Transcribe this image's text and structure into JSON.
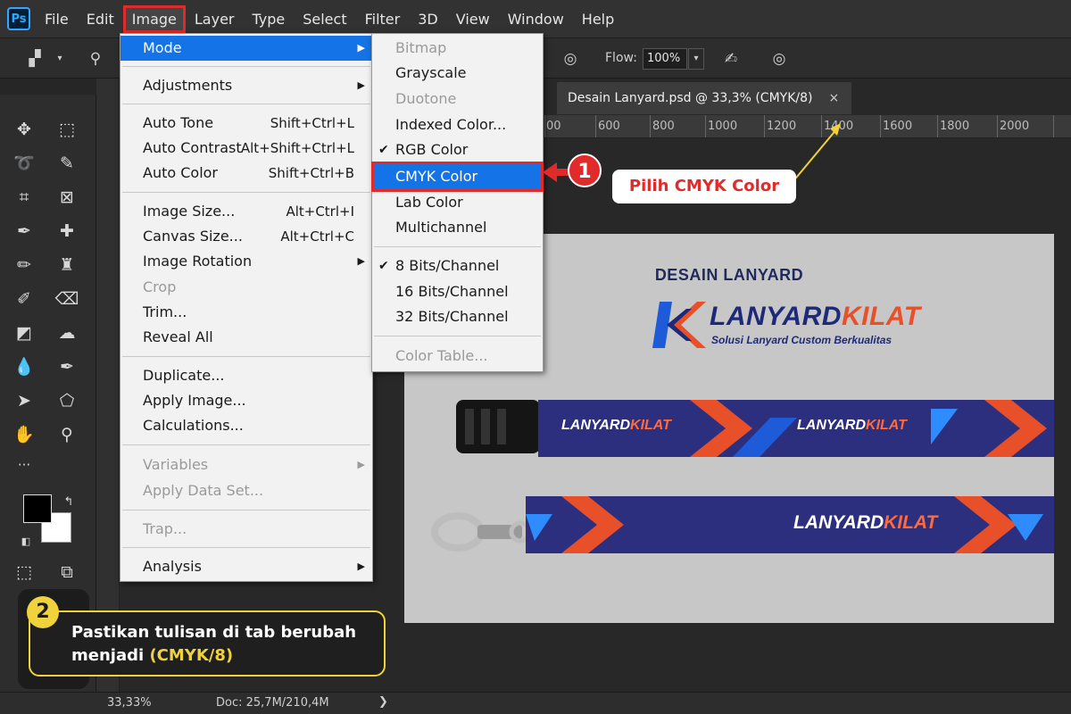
{
  "app": {
    "logo": "Ps"
  },
  "menubar": {
    "items": [
      "File",
      "Edit",
      "Image",
      "Layer",
      "Type",
      "Select",
      "Filter",
      "3D",
      "View",
      "Window",
      "Help"
    ],
    "active": "Image"
  },
  "options": {
    "flow_label": "Flow:",
    "flow_value": "100%"
  },
  "document": {
    "tab_title": "Desain Lanyard.psd @ 33,3% (CMYK/8)",
    "close": "×",
    "ruler_labels": [
      "00",
      "600",
      "800",
      "1000",
      "1200",
      "1400",
      "1600",
      "1800",
      "2000"
    ]
  },
  "image_menu": {
    "mode": "Mode",
    "adjustments": "Adjustments",
    "auto_tone": "Auto Tone",
    "auto_tone_sc": "Shift+Ctrl+L",
    "auto_contrast": "Auto Contrast",
    "auto_contrast_sc": "Alt+Shift+Ctrl+L",
    "auto_color": "Auto Color",
    "auto_color_sc": "Shift+Ctrl+B",
    "image_size": "Image Size...",
    "image_size_sc": "Alt+Ctrl+I",
    "canvas_size": "Canvas Size...",
    "canvas_size_sc": "Alt+Ctrl+C",
    "image_rotation": "Image Rotation",
    "crop": "Crop",
    "trim": "Trim...",
    "reveal_all": "Reveal All",
    "duplicate": "Duplicate...",
    "apply_image": "Apply Image...",
    "calculations": "Calculations...",
    "variables": "Variables",
    "apply_data_set": "Apply Data Set...",
    "trap": "Trap...",
    "analysis": "Analysis"
  },
  "mode_menu": {
    "bitmap": "Bitmap",
    "grayscale": "Grayscale",
    "duotone": "Duotone",
    "indexed_color": "Indexed Color...",
    "rgb_color": "RGB Color",
    "cmyk_color": "CMYK Color",
    "lab_color": "Lab Color",
    "multichannel": "Multichannel",
    "bits8": "8 Bits/Channel",
    "bits16": "16 Bits/Channel",
    "bits32": "32 Bits/Channel",
    "color_table": "Color Table...",
    "check": "✔"
  },
  "canvas": {
    "design_title": "DESAIN LANYARD",
    "brand_main": "LANYARD",
    "brand_accent": "KILAT",
    "tagline": "Solusi Lanyard Custom Berkualitas"
  },
  "annotations": {
    "step1_number": "1",
    "step1_text": "Pilih CMYK Color",
    "step2_number": "2",
    "step2_text": "Pastikan tulisan di tab berubah menjadi",
    "step2_highlight": "(CMYK/8)"
  },
  "status": {
    "zoom": "33,33%",
    "doc": "Doc: 25,7M/210,4M",
    "arrow": "❯"
  },
  "colors": {
    "highlight_blue": "#1473e6",
    "annotation_red": "#e12a2a",
    "annotation_yellow": "#f0d23c",
    "brand_navy": "#2b2f7e",
    "brand_orange": "#e8502a"
  }
}
